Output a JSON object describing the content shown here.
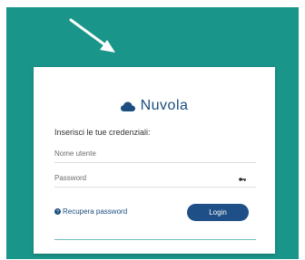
{
  "brand": {
    "name": "Nuvola",
    "icon": "cloud-icon"
  },
  "login": {
    "prompt": "Inserisci le tue credenziali:",
    "username_placeholder": "Nome utente",
    "password_placeholder": "Password",
    "password_icon": "key-icon",
    "forgot_label": "Recupera password",
    "forgot_icon": "help-icon",
    "submit_label": "Login"
  },
  "colors": {
    "frame": "#1a958a",
    "brand": "#1b4d80",
    "button": "#1e4f86",
    "divider": "#6fc2bc"
  }
}
